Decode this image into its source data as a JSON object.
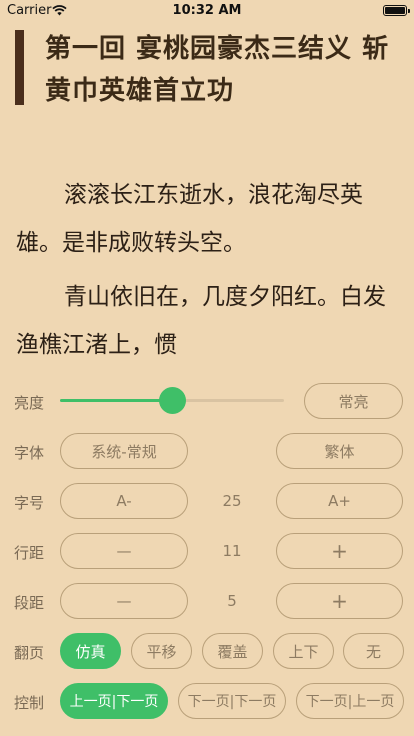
{
  "status_bar": {
    "carrier": "Carrier",
    "time": "10:32 AM"
  },
  "chapter": {
    "title": "第一回 宴桃园豪杰三结义 斩黄巾英雄首立功"
  },
  "content": {
    "paragraph1": "滚滚长江东逝水，浪花淘尽英雄。是非成败转头空。",
    "paragraph2": "青山依旧在，几度夕阳红。白发渔樵江渚上，惯"
  },
  "settings": {
    "brightness": {
      "label": "亮度",
      "level": 0.5,
      "keep_on_label": "常亮"
    },
    "font": {
      "label": "字体",
      "family_label": "系统-常规",
      "traditional_label": "繁体"
    },
    "font_size": {
      "label": "字号",
      "decrease": "A-",
      "value": "25",
      "increase": "A+"
    },
    "line_spacing": {
      "label": "行距",
      "decrease": "—",
      "value": "11",
      "increase": "+"
    },
    "paragraph_spacing": {
      "label": "段距",
      "decrease": "—",
      "value": "5",
      "increase": "+"
    },
    "page_turn": {
      "label": "翻页",
      "options": [
        "仿真",
        "平移",
        "覆盖",
        "上下",
        "无"
      ],
      "selected": "仿真"
    },
    "control": {
      "label": "控制",
      "options": [
        "上一页|下一页",
        "下一页|下一页",
        "下一页|上一页"
      ],
      "selected": "上一页|下一页"
    }
  },
  "colors": {
    "background": "#efd7b3",
    "accent": "#3fbf68",
    "title_bar": "#4a2e1c"
  }
}
